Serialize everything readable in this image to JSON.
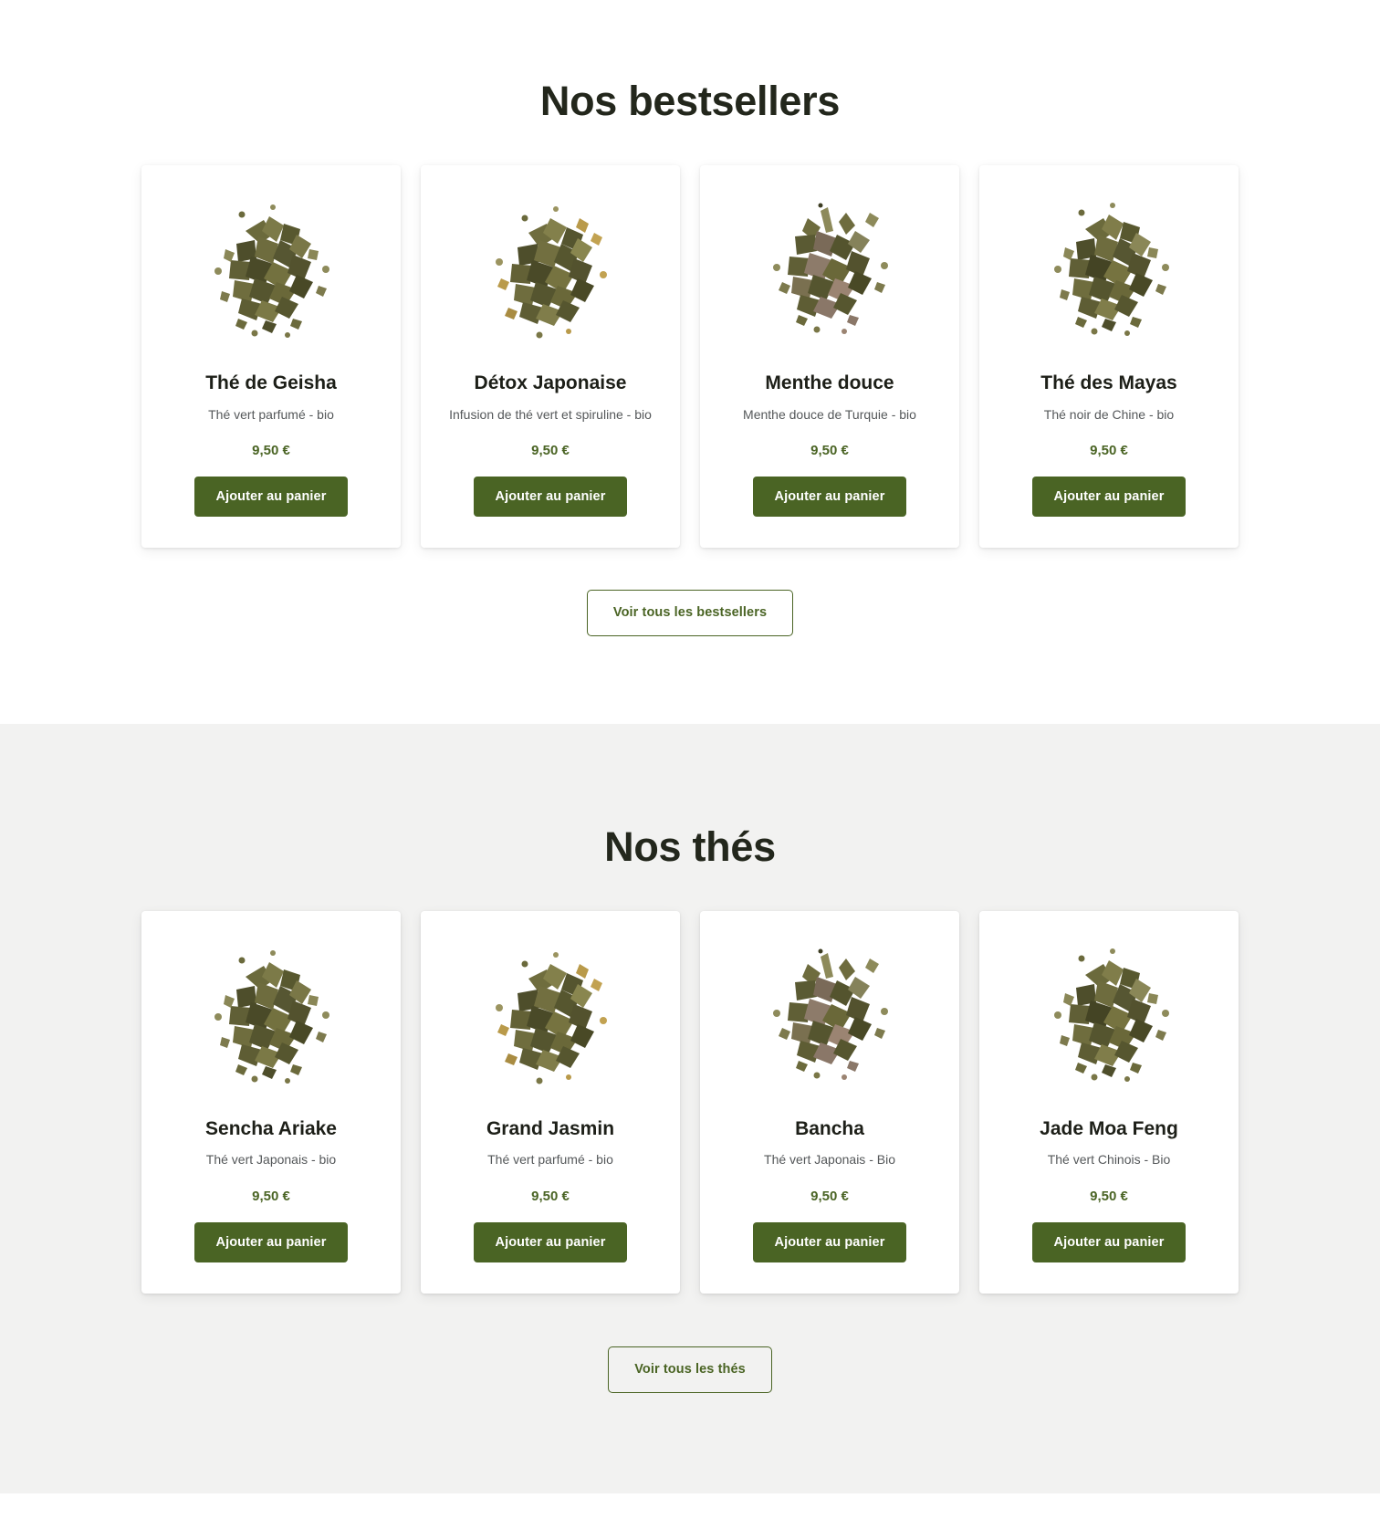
{
  "colors": {
    "accent_green": "#4a6424",
    "title_dark": "#23271c",
    "subtitle_grey": "#55585a",
    "page_bg": "#ffffff",
    "section_bg_grey": "#f2f2f1",
    "card_bg": "#ffffff"
  },
  "sections": [
    {
      "id": "bestsellers",
      "title": "Nos bestsellers",
      "background": "white",
      "cta": {
        "label": "Voir tous les bestsellers",
        "style": "outline"
      },
      "products": [
        {
          "name": "Thé de Geisha",
          "subtitle": "Thé vert parfumé - bio",
          "price": "9,50 €",
          "add_label": "Ajouter au panier",
          "image": "loose-leaf-green-tea-pile"
        },
        {
          "name": "Détox Japonaise",
          "subtitle": "Infusion de thé vert et spiruline - bio",
          "price": "9,50 €",
          "add_label": "Ajouter au panier",
          "image": "loose-leaf-detox-tea-pile"
        },
        {
          "name": "Menthe douce",
          "subtitle": "Menthe douce de Turquie - bio",
          "price": "9,50 €",
          "add_label": "Ajouter au panier",
          "image": "dried-mint-leaf-pile"
        },
        {
          "name": "Thé des Mayas",
          "subtitle": "Thé noir de Chine - bio",
          "price": "9,50 €",
          "add_label": "Ajouter au panier",
          "image": "loose-leaf-black-tea-pile"
        }
      ]
    },
    {
      "id": "thes",
      "title": "Nos thés",
      "background": "grey",
      "cta": {
        "label": "Voir tous les thés",
        "style": "outline"
      },
      "products": [
        {
          "name": "Sencha Ariake",
          "subtitle": "Thé vert Japonais - bio",
          "price": "9,50 €",
          "add_label": "Ajouter au panier",
          "image": "loose-leaf-green-tea-pile"
        },
        {
          "name": "Grand Jasmin",
          "subtitle": "Thé vert parfumé - bio",
          "price": "9,50 €",
          "add_label": "Ajouter au panier",
          "image": "loose-leaf-detox-tea-pile"
        },
        {
          "name": "Bancha",
          "subtitle": "Thé vert Japonais - Bio",
          "price": "9,50 €",
          "add_label": "Ajouter au panier",
          "image": "dried-mint-leaf-pile"
        },
        {
          "name": "Jade Moa Feng",
          "subtitle": "Thé vert Chinois - Bio",
          "price": "9,50 €",
          "add_label": "Ajouter au panier",
          "image": "loose-leaf-black-tea-pile"
        }
      ]
    }
  ]
}
